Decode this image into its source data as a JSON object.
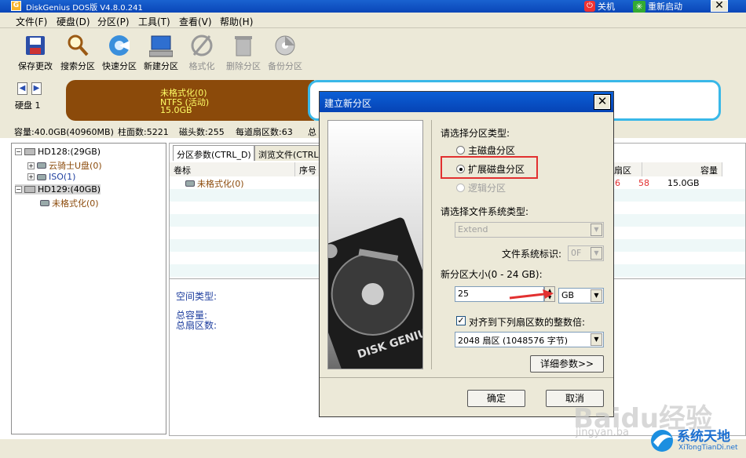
{
  "window": {
    "title": "DiskGenius DOS版 V4.8.0.241",
    "shutdown": "关机",
    "restart": "重新启动"
  },
  "menu": [
    "文件(F)",
    "硬盘(D)",
    "分区(P)",
    "工具(T)",
    "查看(V)",
    "帮助(H)"
  ],
  "toolbar": [
    {
      "label": "保存更改",
      "icon": "save-icon",
      "enabled": true
    },
    {
      "label": "搜索分区",
      "icon": "search-icon",
      "enabled": true
    },
    {
      "label": "快速分区",
      "icon": "quick-partition-icon",
      "enabled": true
    },
    {
      "label": "新建分区",
      "icon": "new-partition-icon",
      "enabled": true
    },
    {
      "label": "格式化",
      "icon": "format-icon",
      "enabled": false
    },
    {
      "label": "删除分区",
      "icon": "delete-icon",
      "enabled": false
    },
    {
      "label": "备份分区",
      "icon": "backup-icon",
      "enabled": false
    }
  ],
  "diskbar": {
    "disk_label": "硬盘 1",
    "part_name": "未格式化(0)",
    "part_fs": "NTFS (活动)",
    "part_size": "15.0GB"
  },
  "info": {
    "capacity": "容量:40.0GB(40960MB)",
    "cylinders": "柱面数:5221",
    "heads": "磁头数:255",
    "sectors": "每道扇区数:63",
    "more": "总"
  },
  "tree": {
    "disk1": "HD128:(29GB)",
    "disk1_items": [
      "云骑士U盘(0)",
      "ISO(1)"
    ],
    "disk2": "HD129:(40GB)",
    "disk2_items": [
      "未格式化(0)"
    ]
  },
  "right": {
    "tabs": [
      "分区参数(CTRL_D)",
      "浏览文件(CTRL"
    ],
    "columns": [
      "卷标",
      "序号",
      "扇区",
      "容量"
    ],
    "row": {
      "label": "未格式化(0)",
      "col_a": "6",
      "sector": "58",
      "size": "15.0GB"
    },
    "space_type": "空间类型:",
    "total_capacity": "总容量:",
    "total_sectors": "总扇区数:"
  },
  "dialog": {
    "title": "建立新分区",
    "type_prompt": "请选择分区类型:",
    "types": [
      {
        "label": "主磁盘分区",
        "selected": false,
        "enabled": true
      },
      {
        "label": "扩展磁盘分区",
        "selected": true,
        "enabled": true
      },
      {
        "label": "逻辑分区",
        "selected": false,
        "enabled": false
      }
    ],
    "fs_prompt": "请选择文件系统类型:",
    "fs_value": "Extend",
    "fs_id_label": "文件系统标识:",
    "fs_id_value": "0F",
    "size_label": "新分区大小(0 - 24 GB):",
    "size_value": "25",
    "unit": "GB",
    "align_label": "对齐到下列扇区数的整数倍:",
    "align_checked": true,
    "align_value": "2048 扇区 (1048576 字节)",
    "details_button": "详细参数>>",
    "ok_button": "确定",
    "cancel_button": "取消",
    "art_text": "DISK GENIUS"
  },
  "watermark": {
    "baidu": "Baidu经验",
    "url": "jingyan.ba",
    "site": "系统天地",
    "site_url": "XiTongTianDi.net"
  },
  "colors": {
    "title_blue": "#0a46b8",
    "partition_brown": "#8b4a0a",
    "partition_text": "#ffff66",
    "highlight_red": "#e23030",
    "selected_cyan": "#39b8e8"
  }
}
